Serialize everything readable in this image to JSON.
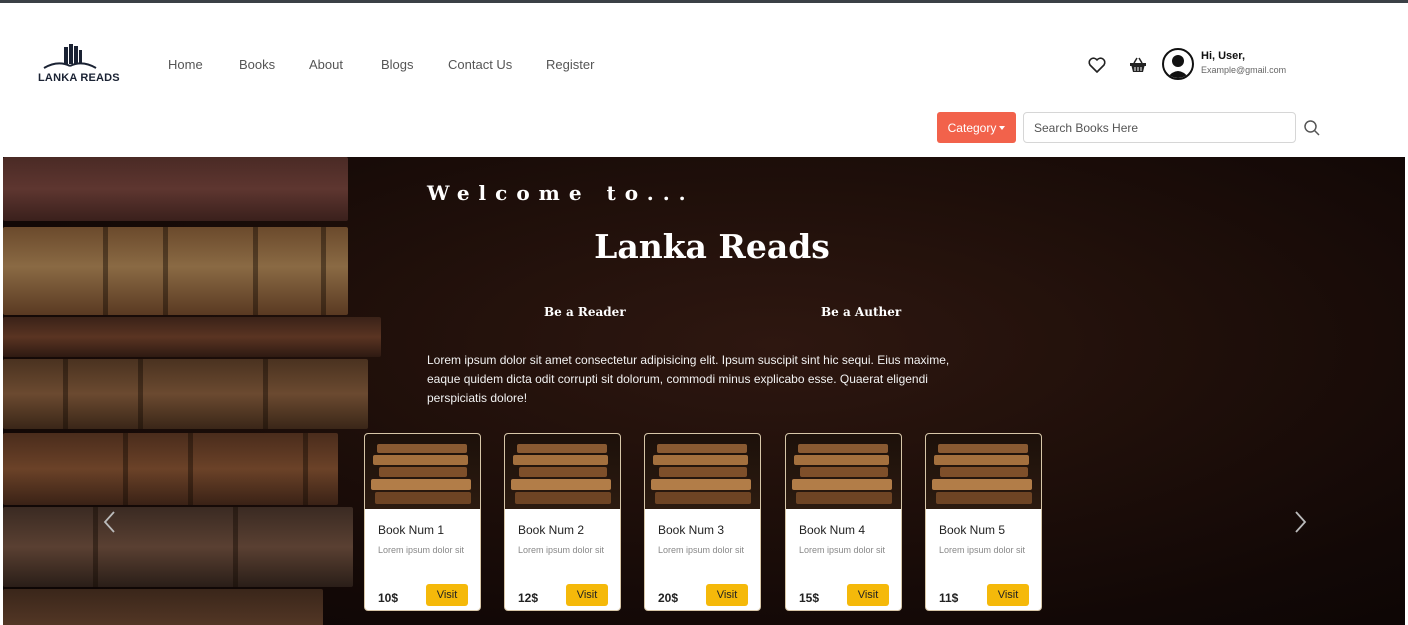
{
  "brand": {
    "logo_text": "LANKA READS",
    "logo_icon": "open-book-icon"
  },
  "nav": {
    "items": [
      "Home",
      "Books",
      "About",
      "Blogs",
      "Contact Us",
      "Register"
    ]
  },
  "header_icons": [
    "heart-icon",
    "basket-icon"
  ],
  "user": {
    "greeting": "Hi, User,",
    "email": "Example@gmail.com"
  },
  "search": {
    "category_label": "Category",
    "placeholder": "Search Books Here"
  },
  "hero": {
    "welcome": "Welcome to...",
    "title": "Lanka Reads",
    "roles": [
      "Be a Reader",
      "Be a Auther"
    ],
    "description": "Lorem ipsum dolor sit amet consectetur adipisicing elit. Ipsum suscipit sint hic sequi. Eius maxime, eaque quidem dicta odit corrupti sit dolorum, commodi minus explicabo esse. Quaerat eligendi perspiciatis dolore!"
  },
  "books": [
    {
      "title": "Book Num 1",
      "desc": "Lorem ipsum dolor sit",
      "price": "10$",
      "button": "Visit"
    },
    {
      "title": "Book Num 2",
      "desc": "Lorem ipsum dolor sit",
      "price": "12$",
      "button": "Visit"
    },
    {
      "title": "Book Num 3",
      "desc": "Lorem ipsum dolor sit",
      "price": "20$",
      "button": "Visit"
    },
    {
      "title": "Book Num 4",
      "desc": "Lorem ipsum dolor sit",
      "price": "15$",
      "button": "Visit"
    },
    {
      "title": "Book Num 5",
      "desc": "Lorem ipsum dolor sit",
      "price": "11$",
      "button": "Visit"
    }
  ],
  "colors": {
    "accent": "#f2624b",
    "visit_button": "#f5b90a",
    "hero_bg": "#1f0f0a"
  }
}
